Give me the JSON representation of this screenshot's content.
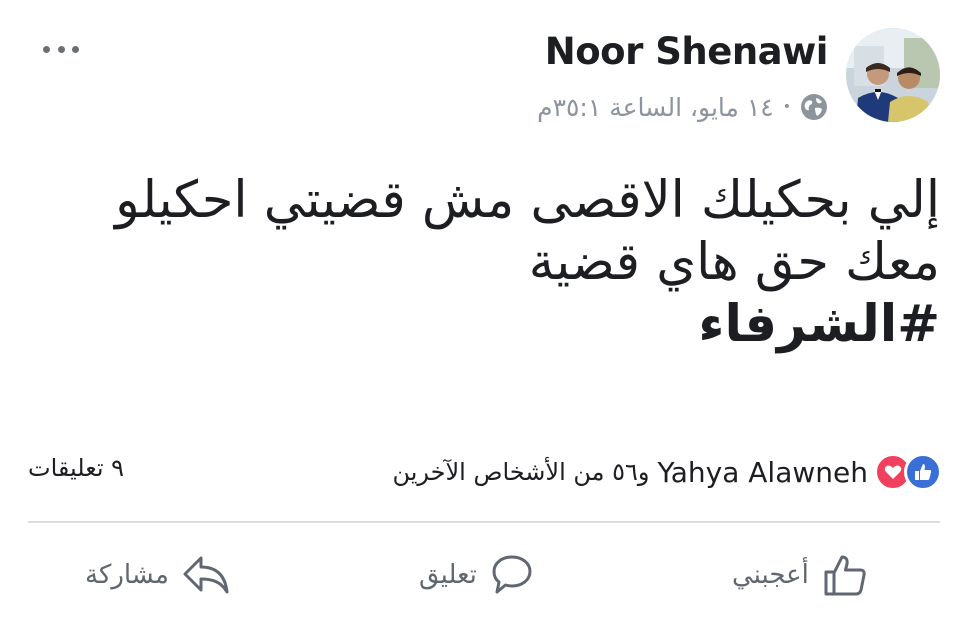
{
  "post": {
    "author": "Noor Shenawi",
    "date": "١٤ مايو، الساعة ٣٥:١م",
    "separator": "•",
    "privacy_icon": "globe-icon",
    "text_lines": [
      "إلي بحكيلك الاقصى مش قضيتي احكيلو",
      "معك حق هاي قضية"
    ],
    "hashtag": "#الشرفاء"
  },
  "reactions": {
    "icons": [
      "like-reaction-icon",
      "love-reaction-icon"
    ],
    "reactor_name": "Yahya Alawneh",
    "others": "و٥٦ من الأشخاص الآخرين",
    "comments": "٩ تعليقات"
  },
  "actions": {
    "like": "أعجبني",
    "comment": "تعليق",
    "share": "مشاركة"
  },
  "colors": {
    "like_blue": "#3b6fd8",
    "love_red": "#f0405e",
    "meta_gray": "#8d949e",
    "action_gray": "#606770",
    "divider": "#dadde1"
  }
}
